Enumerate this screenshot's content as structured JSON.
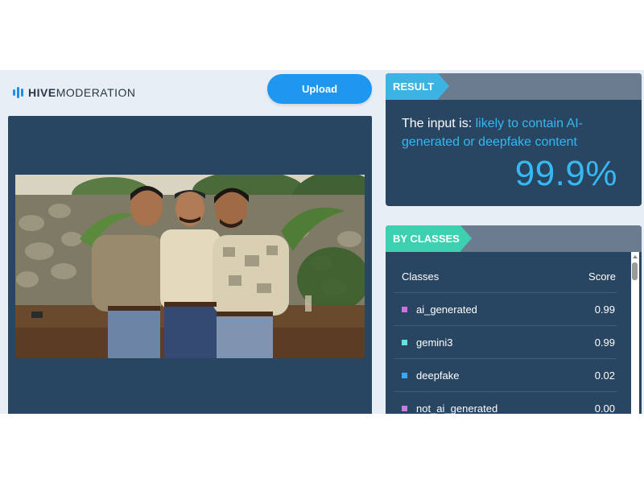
{
  "header": {
    "brand_bold": "HIVE",
    "brand_light": "MODERATION",
    "upload_label": "Upload"
  },
  "result": {
    "tag": "RESULT",
    "prefix": "The input is: ",
    "verdict": "likely to contain AI-generated or deepfake content",
    "score": "99.9%"
  },
  "classes": {
    "tag": "BY CLASSES",
    "col_class": "Classes",
    "col_score": "Score",
    "rows": [
      {
        "name": "ai_generated",
        "score": "0.99",
        "color": "#d070e0"
      },
      {
        "name": "gemini3",
        "score": "0.99",
        "color": "#5ee6d8"
      },
      {
        "name": "deepfake",
        "score": "0.02",
        "color": "#3aa8f2"
      },
      {
        "name": "not_ai_generated",
        "score": "0.00",
        "color": "#c57ee0"
      }
    ]
  },
  "colors": {
    "accent": "#1e97f0",
    "panel": "#284562",
    "highlight": "#36b8f2"
  }
}
